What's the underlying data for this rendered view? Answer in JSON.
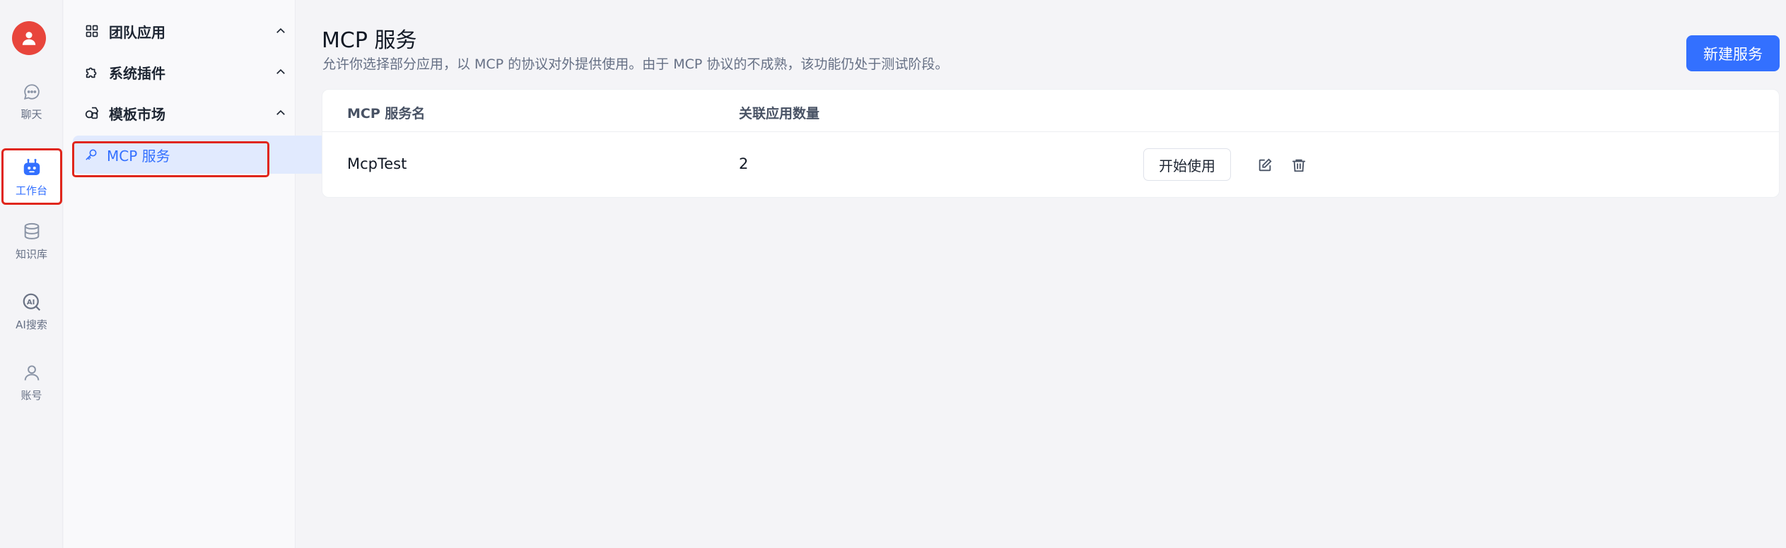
{
  "rail": {
    "items": [
      {
        "label": "聊天",
        "icon": "chat-icon"
      },
      {
        "label": "工作台",
        "icon": "robot-icon",
        "active": true
      },
      {
        "label": "知识库",
        "icon": "database-icon"
      },
      {
        "label": "AI搜索",
        "icon": "ai-search-icon"
      },
      {
        "label": "账号",
        "icon": "user-icon"
      }
    ]
  },
  "sidebar": {
    "groups": [
      {
        "label": "团队应用",
        "icon": "grid-icon"
      },
      {
        "label": "系统插件",
        "icon": "puzzle-icon"
      },
      {
        "label": "模板市场",
        "icon": "shapes-icon"
      }
    ],
    "active_item": {
      "label": "MCP 服务",
      "icon": "key-icon"
    }
  },
  "main": {
    "title": "MCP 服务",
    "description": "允许你选择部分应用，以 MCP 的协议对外提供使用。由于 MCP 协议的不成熟，该功能仍处于测试阶段。",
    "new_button": "新建服务",
    "table": {
      "columns": [
        "MCP 服务名",
        "关联应用数量"
      ],
      "rows": [
        {
          "name": "McpTest",
          "count": "2",
          "action": "开始使用"
        }
      ]
    }
  },
  "colors": {
    "accent": "#3370ff",
    "highlight_box": "#e0261b",
    "avatar": "#e8453c"
  }
}
